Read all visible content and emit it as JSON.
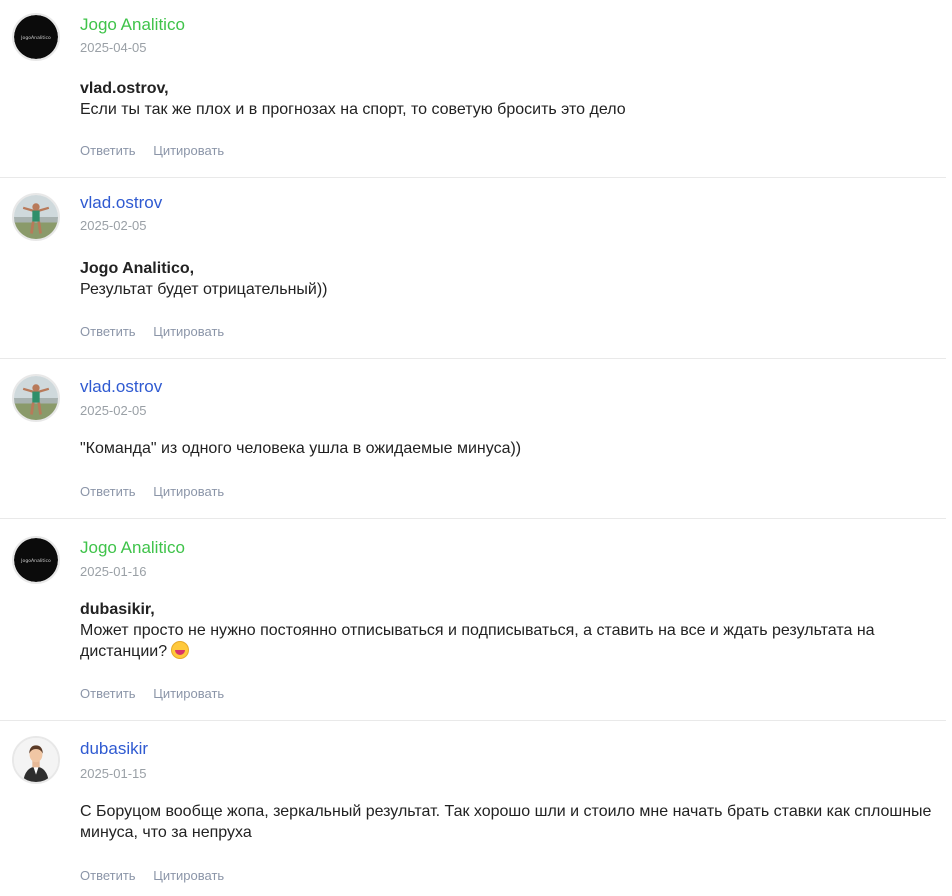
{
  "comments": [
    {
      "author": "Jogo Analitico",
      "author_color": "#3fc34a",
      "avatar": "jogo-logo-avatar",
      "date": "2025-04-05",
      "mention": "vlad.ostrov",
      "text": "Если ты так же плох и в прогнозах на спорт, то советую бросить это дело",
      "reply_label": "Ответить",
      "quote_label": "Цитировать"
    },
    {
      "author": "vlad.ostrov",
      "author_color": "#2f5ad1",
      "avatar": "person-photo-avatar",
      "date": "2025-02-05",
      "mention": "Jogo Analitico",
      "text": "Результат будет отрицательный))",
      "reply_label": "Ответить",
      "quote_label": "Цитировать"
    },
    {
      "author": "vlad.ostrov",
      "author_color": "#2f5ad1",
      "avatar": "person-photo-avatar",
      "date": "2025-02-05",
      "mention": "",
      "text": "\"Команда\" из одного человека ушла в ожидаемые минуса))",
      "reply_label": "Ответить",
      "quote_label": "Цитировать"
    },
    {
      "author": "Jogo Analitico",
      "author_color": "#3fc34a",
      "avatar": "jogo-logo-avatar",
      "date": "2025-01-16",
      "mention": "dubasikir",
      "text": "Может просто не нужно постоянно отписываться и подписываться, а ставить на все и ждать результата на дистанции?",
      "emoji": "grinning-sweat-emoji",
      "reply_label": "Ответить",
      "quote_label": "Цитировать"
    },
    {
      "author": "dubasikir",
      "author_color": "#2f5ad1",
      "avatar": "man-in-suit-avatar",
      "date": "2025-01-15",
      "mention": "",
      "text": "С Боруцом вообще жопа, зеркальный результат. Так хорошо шли и стоило мне начать брать ставки как сплошные минуса, что за непруха",
      "reply_label": "Ответить",
      "quote_label": "Цитировать"
    }
  ],
  "logo_text": "JogoAnalitico"
}
